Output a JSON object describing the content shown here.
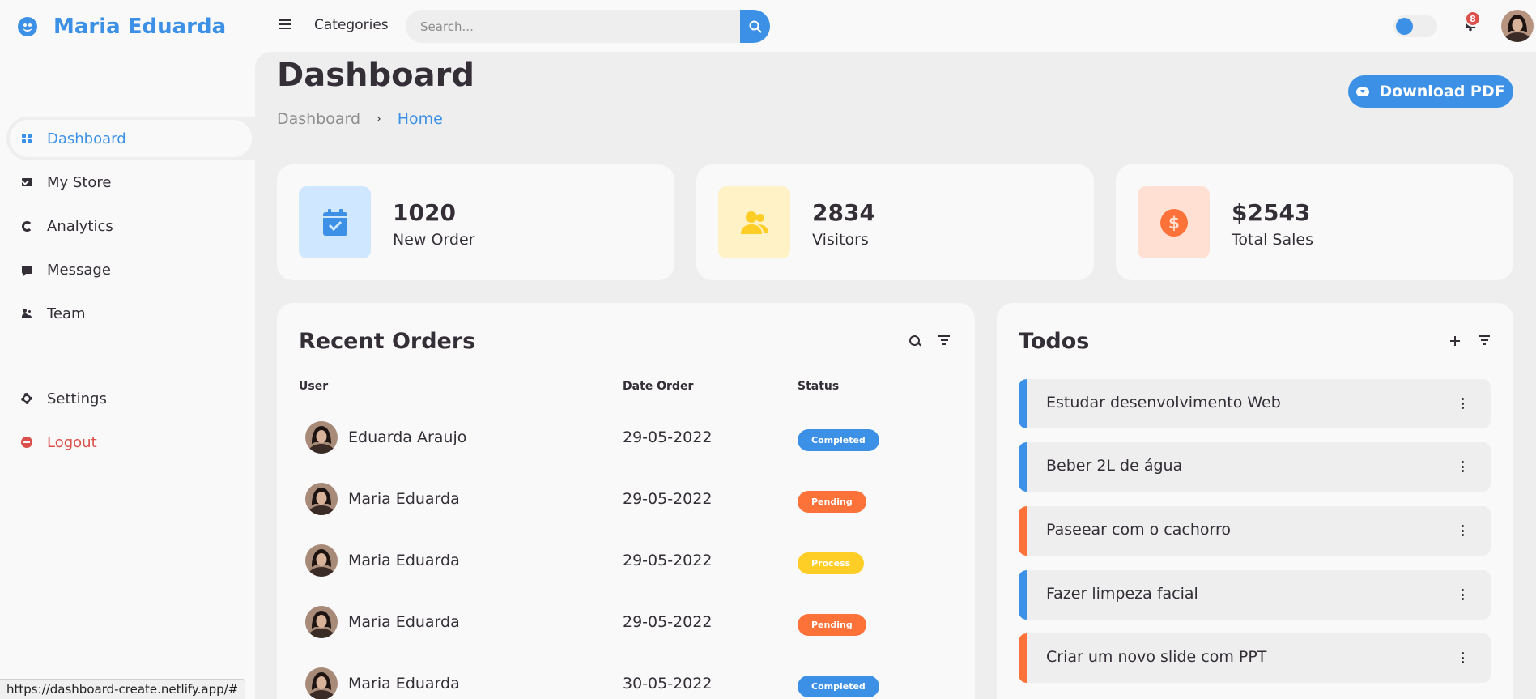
{
  "brand": {
    "name": "Maria Eduarda",
    "icon": "smile-icon"
  },
  "sidebar": {
    "items": [
      {
        "label": "Dashboard",
        "icon": "dashboard-icon",
        "active": true
      },
      {
        "label": "My Store",
        "icon": "store-icon"
      },
      {
        "label": "Analytics",
        "icon": "analytics-icon"
      },
      {
        "label": "Message",
        "icon": "message-icon"
      },
      {
        "label": "Team",
        "icon": "team-icon"
      }
    ],
    "bottom": [
      {
        "label": "Settings",
        "icon": "gear-icon"
      },
      {
        "label": "Logout",
        "icon": "logout-icon"
      }
    ]
  },
  "navbar": {
    "categories": "Categories",
    "search_placeholder": "Search...",
    "notification_count": "8"
  },
  "main": {
    "title": "Dashboard",
    "breadcrumb": [
      "Dashboard",
      "Home"
    ],
    "download_label": "Download PDF"
  },
  "stats": [
    {
      "value": "1020",
      "label": "New Order",
      "icon": "calendar-check-icon",
      "bg": "#cfe8ff",
      "color": "#3c91e6"
    },
    {
      "value": "2834",
      "label": "Visitors",
      "icon": "group-icon",
      "bg": "#fff2c6",
      "color": "#ffce26"
    },
    {
      "value": "$2543",
      "label": "Total Sales",
      "icon": "dollar-icon",
      "bg": "#ffe0d3",
      "color": "#fd7238"
    }
  ],
  "orders": {
    "title": "Recent Orders",
    "columns": [
      "User",
      "Date Order",
      "Status"
    ],
    "rows": [
      {
        "user": "Eduarda Araujo",
        "date": "29-05-2022",
        "status": "Completed",
        "color": "#3c91e6"
      },
      {
        "user": "Maria Eduarda",
        "date": "29-05-2022",
        "status": "Pending",
        "color": "#fd7238"
      },
      {
        "user": "Maria Eduarda",
        "date": "29-05-2022",
        "status": "Process",
        "color": "#ffce26"
      },
      {
        "user": "Maria Eduarda",
        "date": "29-05-2022",
        "status": "Pending",
        "color": "#fd7238"
      },
      {
        "user": "Maria Eduarda",
        "date": "30-05-2022",
        "status": "Completed",
        "color": "#3c91e6"
      }
    ]
  },
  "todos": {
    "title": "Todos",
    "items": [
      {
        "text": "Estudar desenvolvimento Web",
        "color": "#3c91e6"
      },
      {
        "text": "Beber 2L de água",
        "color": "#3c91e6"
      },
      {
        "text": "Paseear com o cachorro",
        "color": "#fd7238"
      },
      {
        "text": "Fazer limpeza facial",
        "color": "#3c91e6"
      },
      {
        "text": "Criar um novo slide com PPT",
        "color": "#fd7238"
      }
    ]
  },
  "status_url": "https://dashboard-create.netlify.app/#"
}
